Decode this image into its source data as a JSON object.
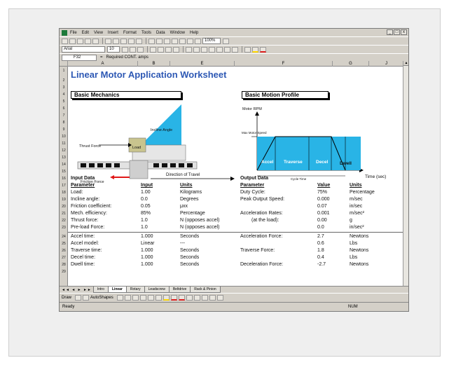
{
  "menu": [
    "File",
    "Edit",
    "View",
    "Insert",
    "Format",
    "Tools",
    "Data",
    "Window",
    "Help"
  ],
  "window_controls": [
    "_",
    "□",
    "x"
  ],
  "toolbar": {
    "font": "Arial",
    "size": "10",
    "zoom": "100%"
  },
  "formula_bar": {
    "cell": "F32",
    "fx": "=",
    "formula": "Required CONT. amps"
  },
  "columns": [
    "A",
    "B",
    "E",
    "F",
    "G",
    "J"
  ],
  "rows": [
    "1",
    "2",
    "3",
    "4",
    "5",
    "6",
    "7",
    "8",
    "9",
    "10",
    "11",
    "12",
    "13",
    "14",
    "15",
    "16",
    "17",
    "18",
    "19",
    "20",
    "21",
    "22",
    "23",
    "24",
    "25",
    "26",
    "27",
    "28",
    "29"
  ],
  "title": "Linear Motor Application Worksheet",
  "sections": {
    "mechanics": "Basic Mechanics",
    "motion": "Basic Motion Profile"
  },
  "mechanics_labels": {
    "incline_angle": "Incline Angle",
    "thrust_force": "Thrust Force",
    "load": "Load",
    "friction_force": "Friction Force",
    "direction": "Direction of Travel"
  },
  "motion_labels": {
    "motor_rpm": "Motor RPM",
    "max_speed": "Max Motor Speed",
    "accel": "Accel",
    "traverse": "Traverse",
    "decel": "Decel",
    "dwell": "Dwell",
    "cycle_time": "Cycle Time",
    "time_axis": "Time (sec)"
  },
  "input": {
    "heading": "Input Data",
    "headers": [
      "Parameter",
      "Input",
      "Units"
    ],
    "rows": [
      [
        "Load:",
        "1.00",
        "Kilograms"
      ],
      [
        "Incline angle:",
        "0.0",
        "Degrees"
      ],
      [
        "Friction coefficient:",
        "0.05",
        "μxx"
      ],
      [
        "Mech. efficiency:",
        "85%",
        "Percentage"
      ],
      [
        "Thrust force:",
        "1.0",
        "N (opposes accel)"
      ],
      [
        "Pre-load Force:",
        "1.0",
        "N (opposes accel)"
      ],
      [
        "Accel time:",
        "1.000",
        "Seconds"
      ],
      [
        "Accel model:",
        "Linear",
        "---"
      ],
      [
        "Traverse time:",
        "1.000",
        "Seconds"
      ],
      [
        "Decel time:",
        "1.000",
        "Seconds"
      ],
      [
        "Dwell time:",
        "1.000",
        "Seconds"
      ]
    ]
  },
  "output": {
    "heading": "Output Data",
    "headers": [
      "Parameter",
      "Value",
      "Units"
    ],
    "rows": [
      [
        "Duty Cycle:",
        "75%",
        "Percentage"
      ],
      [
        "Peak Output Speed:",
        "0.000",
        "m/sec"
      ],
      [
        "",
        "0.07",
        "in/sec"
      ],
      [
        "Acceleration Rates:",
        "0.001",
        "m/sec²"
      ],
      [
        "(at the load):",
        "0.00",
        "g"
      ],
      [
        "",
        "0.0",
        "in/sec²"
      ],
      [
        "Acceleration Force:",
        "2.7",
        "Newtons"
      ],
      [
        "",
        "0.6",
        "Lbs"
      ],
      [
        "Traverse Force:",
        "1.8",
        "Newtons"
      ],
      [
        "",
        "0.4",
        "Lbs"
      ],
      [
        "Deceleration Force:",
        "-2.7",
        "Newtons"
      ]
    ]
  },
  "sheet_tabs": [
    "Intro",
    "Linear",
    "Rotary",
    "Leadscrew",
    "Beltdrive",
    "Rack & Pinion"
  ],
  "draw_toolbar": {
    "draw": "Draw",
    "autoshapes": "AutoShapes"
  },
  "status": {
    "ready": "Ready",
    "num": "NUM"
  },
  "colors": {
    "title_blue": "#2d58b4",
    "output_green": "#2f8a1f",
    "motion_fill": "#29b4e6"
  }
}
